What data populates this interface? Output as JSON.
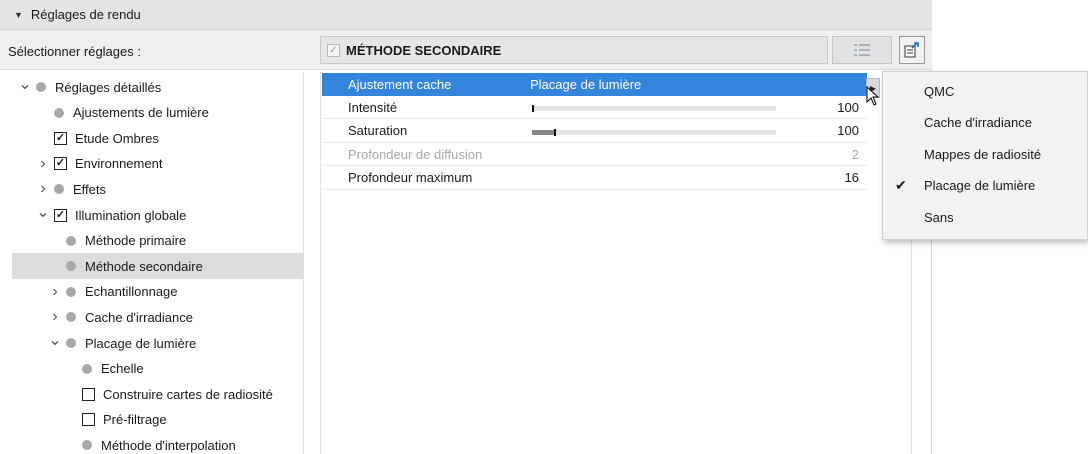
{
  "header": {
    "title": "Réglages de rendu"
  },
  "selector_label": "Sélectionner réglages :",
  "method": {
    "title": "MÉTHODE SECONDAIRE"
  },
  "tree": [
    {
      "label": "Réglages détaillés",
      "chevron": "down",
      "marker": "dot",
      "level": 0
    },
    {
      "label": "Ajustements de lumière",
      "chevron": "",
      "marker": "dot",
      "level": 1
    },
    {
      "label": "Etude Ombres",
      "chevron": "",
      "marker": "checked",
      "level": 1
    },
    {
      "label": "Environnement",
      "chevron": "right",
      "marker": "checked",
      "level": 1
    },
    {
      "label": "Effets",
      "chevron": "right",
      "marker": "dot",
      "level": 1
    },
    {
      "label": "Illumination globale",
      "chevron": "down",
      "marker": "checked",
      "level": 1
    },
    {
      "label": "Méthode primaire",
      "chevron": "",
      "marker": "dot",
      "level": 2
    },
    {
      "label": "Méthode secondaire",
      "chevron": "",
      "marker": "dot",
      "level": 2,
      "selected": true
    },
    {
      "label": "Echantillonnage",
      "chevron": "right",
      "marker": "dot",
      "level": 2
    },
    {
      "label": "Cache d'irradiance",
      "chevron": "right",
      "marker": "dot",
      "level": 2
    },
    {
      "label": "Placage de lumière",
      "chevron": "down",
      "marker": "dot",
      "level": 2
    },
    {
      "label": "Echelle",
      "chevron": "",
      "marker": "dot",
      "level": 3
    },
    {
      "label": "Construire cartes de radiosité",
      "chevron": "",
      "marker": "unchecked",
      "level": 3
    },
    {
      "label": "Pré-filtrage",
      "chevron": "",
      "marker": "unchecked",
      "level": 3
    },
    {
      "label": "Méthode d'interpolation",
      "chevron": "",
      "marker": "dot",
      "level": 3
    }
  ],
  "properties": [
    {
      "name": "Ajustement cache",
      "value": "Placage de lumière",
      "highlight": true
    },
    {
      "name": "Intensité",
      "number": "100",
      "slider": 0.0
    },
    {
      "name": "Saturation",
      "number": "100",
      "slider": 0.09
    },
    {
      "name": "Profondeur de diffusion",
      "number": "2",
      "disabled": true
    },
    {
      "name": "Profondeur maximum",
      "number": "16"
    }
  ],
  "dropdown": {
    "options": [
      {
        "label": "QMC",
        "checked": false
      },
      {
        "label": "Cache d'irradiance",
        "checked": false
      },
      {
        "label": "Mappes de radiosité",
        "checked": false
      },
      {
        "label": "Placage de lumière",
        "checked": true
      },
      {
        "label": "Sans",
        "checked": false
      }
    ]
  },
  "icons": {
    "header_toggle": "triangle-down-icon",
    "list": "list-icon",
    "export": "export-icon",
    "submenu": "arrow-right-icon",
    "cursor": "mouse-pointer-icon"
  },
  "colors": {
    "highlight": "#3584dc",
    "selected_row": "#dcdcdc"
  }
}
